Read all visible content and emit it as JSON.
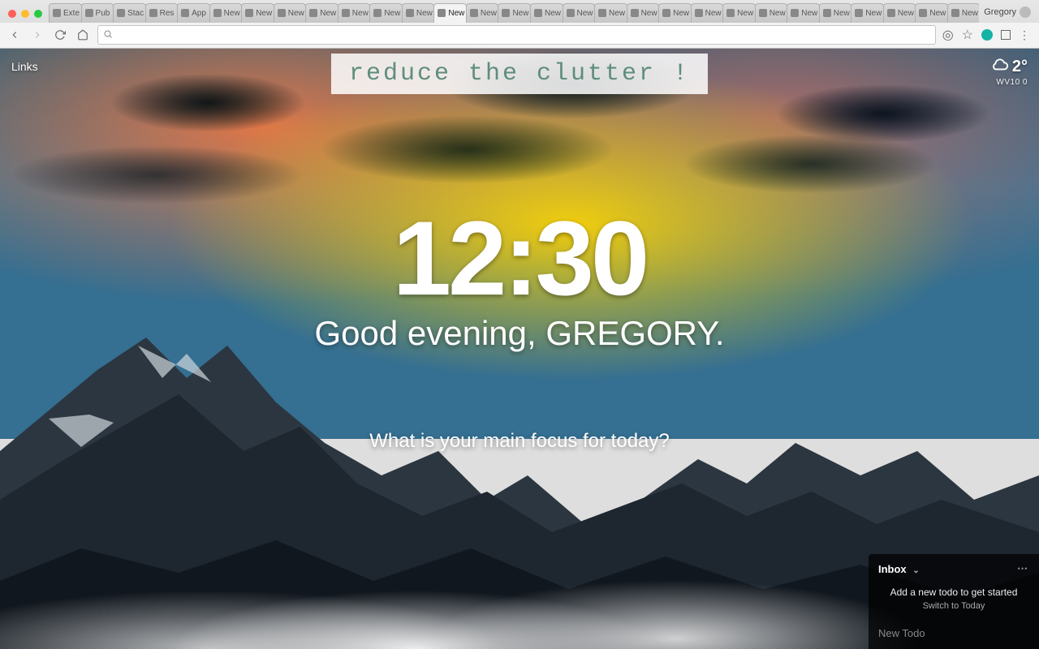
{
  "browser": {
    "profile_name": "Gregory",
    "tabs": [
      {
        "title": "Exte",
        "active": false
      },
      {
        "title": "Pub",
        "active": false
      },
      {
        "title": "Stac",
        "active": false
      },
      {
        "title": "Res",
        "active": false
      },
      {
        "title": "App",
        "active": false
      },
      {
        "title": "New Ta",
        "active": false
      },
      {
        "title": "New Ta",
        "active": false
      },
      {
        "title": "New Ta",
        "active": false
      },
      {
        "title": "New Ta",
        "active": false
      },
      {
        "title": "New Ta",
        "active": false
      },
      {
        "title": "New Ta",
        "active": false
      },
      {
        "title": "New Ta",
        "active": false
      },
      {
        "title": "New",
        "active": true
      },
      {
        "title": "New Ta",
        "active": false
      },
      {
        "title": "New Ta",
        "active": false
      },
      {
        "title": "New Ta",
        "active": false
      },
      {
        "title": "New Ta",
        "active": false
      },
      {
        "title": "New Ta",
        "active": false
      },
      {
        "title": "New Ta",
        "active": false
      },
      {
        "title": "New Ta",
        "active": false
      },
      {
        "title": "New Ta",
        "active": false
      },
      {
        "title": "New Ta",
        "active": false
      },
      {
        "title": "New Ta",
        "active": false
      },
      {
        "title": "New Ta",
        "active": false
      },
      {
        "title": "New Ta",
        "active": false
      },
      {
        "title": "New Ta",
        "active": false
      },
      {
        "title": "New Ta",
        "active": false
      },
      {
        "title": "New Ta",
        "active": false
      },
      {
        "title": "New Ta",
        "active": false
      }
    ],
    "omnibox_placeholder": ""
  },
  "page": {
    "links_label": "Links",
    "banner_text": "reduce the clutter !",
    "weather": {
      "temp": "2°",
      "location": "WV10 0"
    },
    "clock": "12:30",
    "greeting": "Good evening, GREGORY.",
    "focus_prompt": "What is your main focus for today?"
  },
  "todo": {
    "header": "Inbox",
    "hint": "Add a new todo to get started",
    "switch_label": "Switch to Today",
    "new_placeholder": "New Todo"
  }
}
